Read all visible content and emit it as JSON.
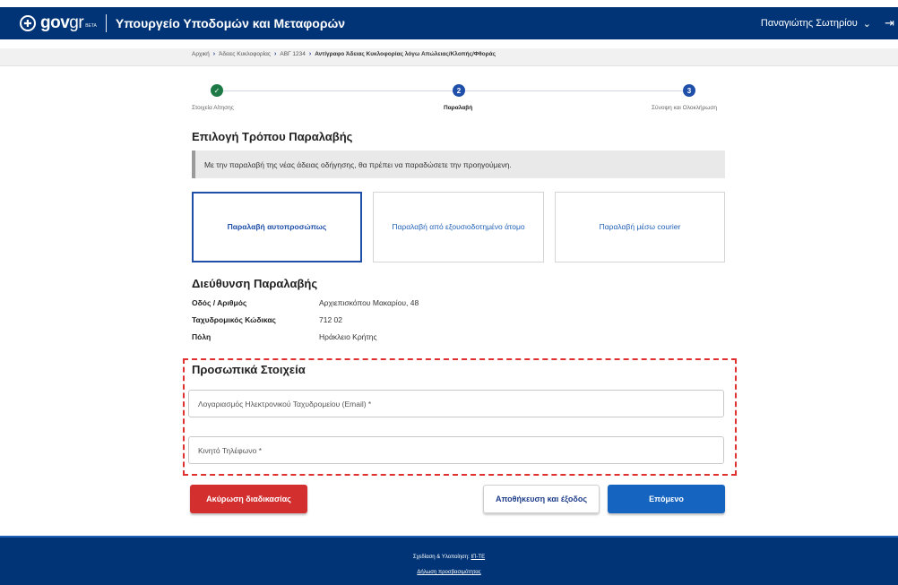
{
  "header": {
    "logo_text": "gov",
    "logo_accent": "gr",
    "beta": "BETA",
    "ministry": "Υπουργείο Υποδομών και Μεταφορών",
    "user_name": "Παναγιώτης Σωτηρίου",
    "user_chevron": "⌄",
    "logout_glyph": "⇥"
  },
  "breadcrumb": {
    "items": [
      "Αρχική",
      "Άδειες Κυκλοφορίας",
      "ΑΒΓ 1234"
    ],
    "current": "Αντίγραφο Άδειας Κυκλοφορίας λόγω Απώλειας/Κλοπής/Φθοράς"
  },
  "stepper": {
    "steps": [
      {
        "number": "✓",
        "label": "Στοιχεία Αίτησης",
        "state": "done"
      },
      {
        "number": "2",
        "label": "Παραλαβή",
        "state": "active"
      },
      {
        "number": "3",
        "label": "Σύνοψη και Ολοκλήρωση",
        "state": "pending"
      }
    ]
  },
  "delivery": {
    "title": "Επιλογή Τρόπου Παραλαβής",
    "notice": "Με την παραλαβή της νέας άδειας οδήγησης, θα πρέπει να παραδώσετε την προηγούμενη.",
    "options": [
      {
        "label": "Παραλαβή αυτοπροσώπως",
        "selected": true
      },
      {
        "label": "Παραλαβή από εξουσιοδοτημένο άτομο",
        "selected": false
      },
      {
        "label": "Παραλαβή μέσω courier",
        "selected": false
      }
    ]
  },
  "address": {
    "title": "Διεύθυνση Παραλαβής",
    "street_label": "Οδός / Αριθμός",
    "street_value": "Αρχιεπισκόπου Μακαρίου, 48",
    "postal_label": "Ταχυδρομικός Κώδικας",
    "postal_value": "712 02",
    "city_label": "Πόλη",
    "city_value": "Ηράκλειο Κρήτης"
  },
  "personal": {
    "title": "Προσωπικά Στοιχεία",
    "email_placeholder": "Λογαριασμός Ηλεκτρονικού Ταχυδρομείου (Email) *",
    "email_value": "",
    "phone_placeholder": "Κινητό Τηλέφωνο *",
    "phone_value": ""
  },
  "actions": {
    "cancel": "Ακύρωση διαδικασίας",
    "save": "Αποθήκευση και έξοδος",
    "next": "Επόμενο"
  },
  "footer": {
    "design_prefix": "Σχεδίαση & Υλοποίηση:",
    "design_link": "ΙΠ-ΤΕ",
    "accessibility": "Δήλωση προσβασιμότητας"
  },
  "colors": {
    "primary": "#003476",
    "accent_blue": "#1565c0",
    "danger": "#d32f2f",
    "success": "#1d7a47",
    "highlight_dash": "#e03030"
  }
}
